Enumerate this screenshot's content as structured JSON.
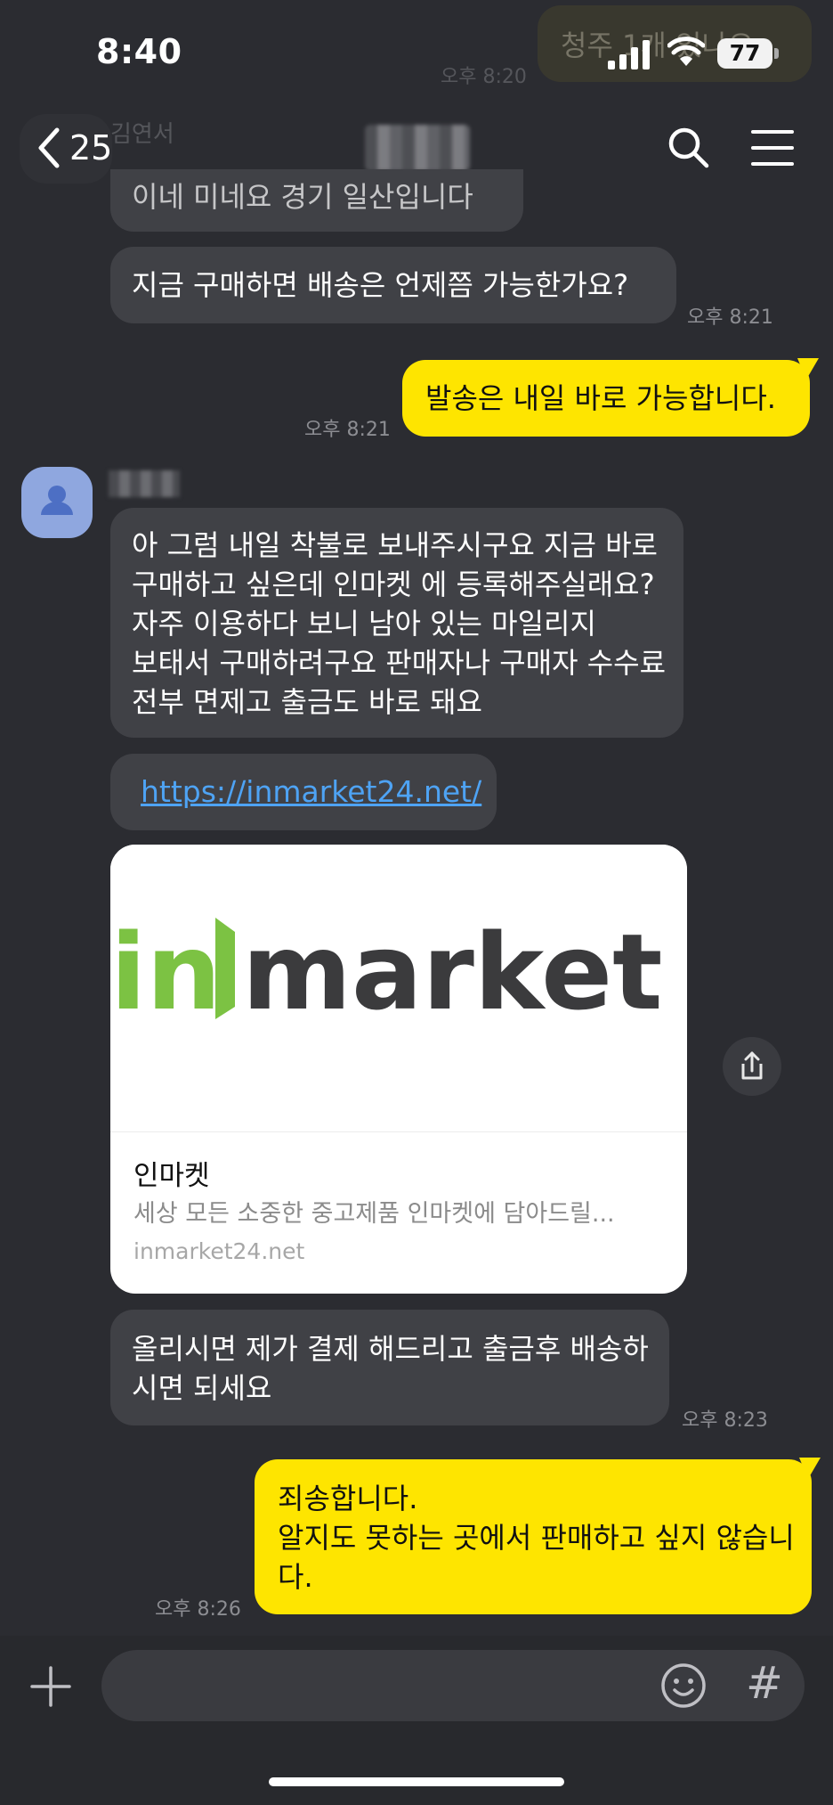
{
  "status_bar": {
    "time": "8:40",
    "battery": "77"
  },
  "toast": {
    "text": "청주 1개 있나요"
  },
  "ghost": {
    "time": "오후 8:20",
    "name": "김연서"
  },
  "nav": {
    "back_count": "25"
  },
  "messages": {
    "partial_top": "이네 미네요 경기 일산입니다",
    "m1": {
      "text": "지금 구매하면 배송은 언제쯤 가능한가요?",
      "time": "오후 8:21"
    },
    "m2": {
      "text": "발송은 내일 바로 가능합니다.",
      "time": "오후 8:21"
    },
    "m3": {
      "text": "아 그럼  내일 착불로 보내주시구요 지금 바로 구매하고 싶은데 인마켓 에 등록해주실래요?  자주 이용하다 보니  남아 있는 마일리지 보태서 구매하려구요  판매자나 구매자 수수료 전부 면제고 출금도 바로 돼요"
    },
    "m4": {
      "link": "https://inmarket24.net/"
    },
    "card": {
      "logo_in": "in",
      "logo_market": "market",
      "title": "인마켓",
      "description": "세상 모든 소중한 중고제품 인마켓에 담아드릴...",
      "domain": "inmarket24.net"
    },
    "m5": {
      "text": "올리시면 제가 결제 해드리고 출금후 배송하시면 되세요",
      "time": "오후 8:23"
    },
    "m6": {
      "text": "죄송합니다.\n알지도 못하는 곳에서 판매하고 싶지 않습니다.",
      "time": "오후 8:26"
    }
  },
  "input": {
    "hash": "#"
  },
  "colors": {
    "background": "#2b2c31",
    "incoming": "#404146",
    "outgoing": "#fee500",
    "link": "#4ea3f4",
    "logo_green": "#7cc243",
    "logo_dark": "#3b3b3d"
  }
}
